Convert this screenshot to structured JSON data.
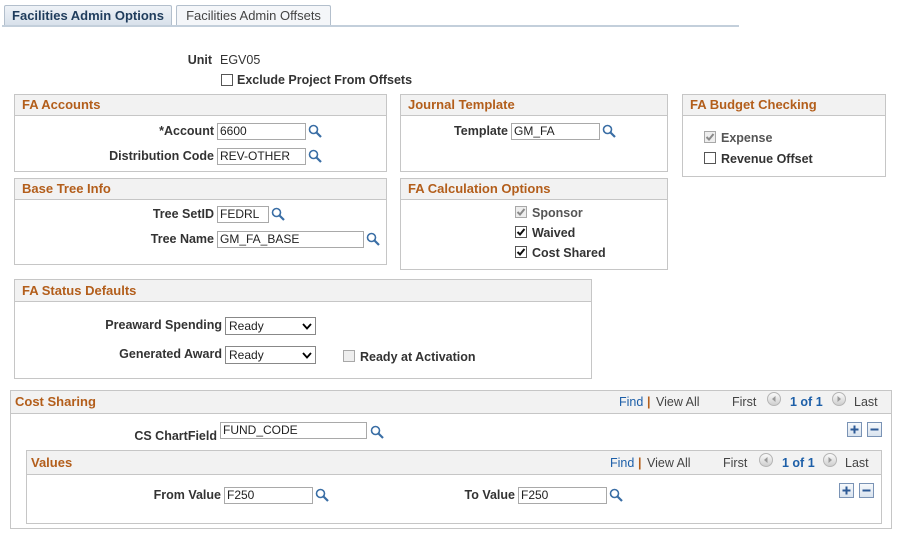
{
  "tabs": [
    {
      "label": "Facilities Admin Options",
      "active": true
    },
    {
      "label": "Facilities Admin Offsets",
      "active": false
    }
  ],
  "unit": {
    "label": "Unit",
    "value": "EGV05"
  },
  "exclude_project": {
    "label": "Exclude Project From Offsets",
    "checked": false
  },
  "fa_accounts": {
    "title": "FA Accounts",
    "account_label": "*Account",
    "account_value": "6600",
    "distribution_label": "Distribution Code",
    "distribution_value": "REV-OTHER"
  },
  "journal_template": {
    "title": "Journal Template",
    "template_label": "Template",
    "template_value": "GM_FA"
  },
  "fa_budget": {
    "title": "FA Budget Checking",
    "expense_label": "Expense",
    "expense_checked": true,
    "revenue_label": "Revenue Offset",
    "revenue_checked": false
  },
  "base_tree": {
    "title": "Base Tree Info",
    "setid_label": "Tree SetID",
    "setid_value": "FEDRL",
    "name_label": "Tree Name",
    "name_value": "GM_FA_BASE"
  },
  "fa_calc": {
    "title": "FA Calculation Options",
    "sponsor_label": "Sponsor",
    "sponsor_checked": true,
    "waived_label": "Waived",
    "waived_checked": true,
    "cost_shared_label": "Cost Shared",
    "cost_shared_checked": true
  },
  "fa_status": {
    "title": "FA Status Defaults",
    "preaward_label": "Preaward Spending",
    "preaward_value": "Ready",
    "generated_label": "Generated Award",
    "generated_value": "Ready",
    "ready_activation_label": "Ready at Activation",
    "ready_activation_checked": false
  },
  "cost_sharing": {
    "title": "Cost Sharing",
    "find": "Find",
    "sep": "|",
    "view_all": "View All",
    "first": "First",
    "pager": "1 of 1",
    "last": "Last",
    "chartfield_label": "CS ChartField",
    "chartfield_value": "FUND_CODE"
  },
  "values": {
    "title": "Values",
    "find": "Find",
    "sep": "|",
    "view_all": "View All",
    "first": "First",
    "pager": "1 of 1",
    "last": "Last",
    "from_label": "From Value",
    "from_value": "F250",
    "to_label": "To Value",
    "to_value": "F250"
  }
}
